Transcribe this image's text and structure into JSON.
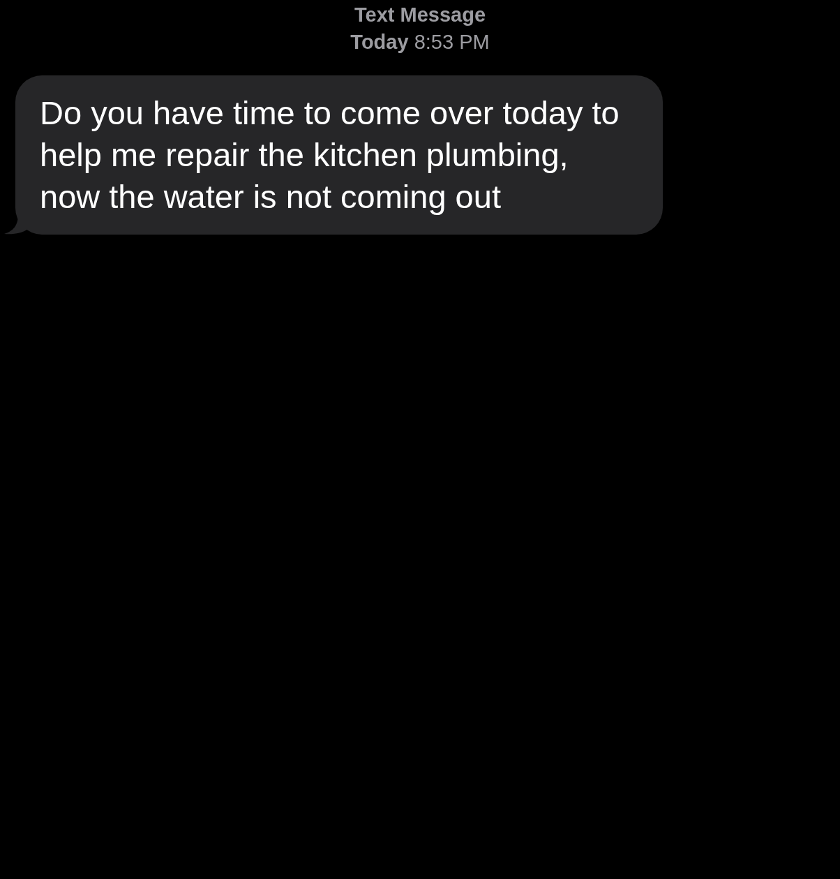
{
  "header": {
    "service": "Text Message",
    "timestamp": "**Today** 8:53 PM"
  },
  "messages": [
    {
      "text": "Do you have time to come over today to help me repair the kitchen plumbing, now the water is not coming out"
    }
  ]
}
